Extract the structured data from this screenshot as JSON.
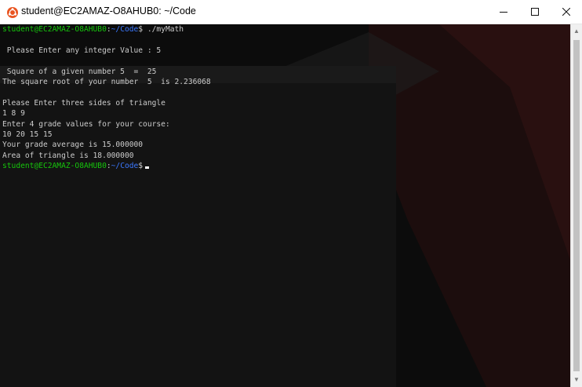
{
  "window": {
    "title": "student@EC2AMAZ-O8AHUB0: ~/Code",
    "controls": {
      "minimize": "—",
      "maximize": "☐",
      "close": "✕"
    }
  },
  "colors": {
    "prompt_user": "#16c60c",
    "prompt_path": "#3b78ff",
    "text": "#cccccc",
    "background": "#0c0c0c",
    "ubuntu_orange": "#e95420"
  },
  "terminal": {
    "prompt_user": "student@EC2AMAZ-O8AHUB0",
    "prompt_path": "~/Code",
    "command": "./myMath",
    "lines": [
      "",
      " Please Enter any integer Value : 5",
      "",
      " Square of a given number 5  =  25",
      "The square root of your number  5  is 2.236068",
      "",
      "Please Enter three sides of triangle",
      "1 8 9",
      "Enter 4 grade values for your course:",
      "10 20 15 15",
      "Your grade average is 15.000000",
      "Area of triangle is 18.000000"
    ]
  },
  "scrollbar": {
    "up_icon": "triangle-up",
    "down_icon": "triangle-down"
  }
}
